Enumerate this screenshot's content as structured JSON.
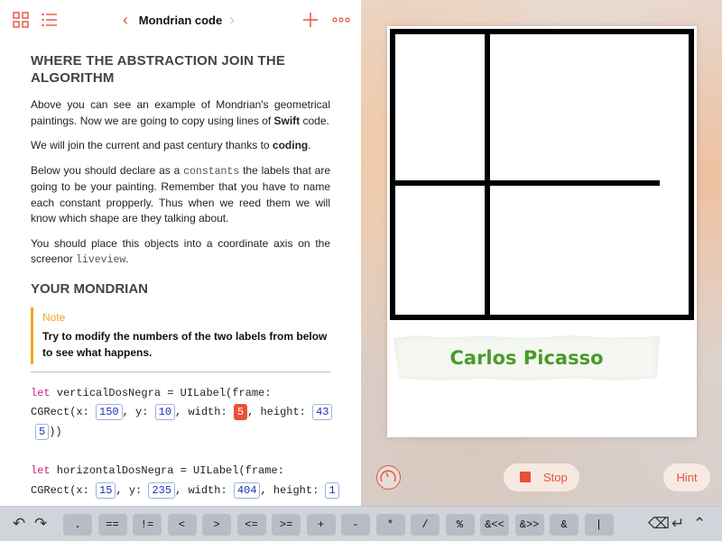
{
  "toolbar": {
    "title": "Mondrian code",
    "icons": [
      "grid-icon",
      "list-icon",
      "chevron-left-icon",
      "chevron-right-icon",
      "plus-icon",
      "more-icon"
    ]
  },
  "doc": {
    "heading1": "WHERE THE ABSTRACTION JOIN THE ALGORITHM",
    "p1": "Above you can see an example of Mondrian's geometrical paintings. Now we are going to copy using lines of ",
    "p1_bold": "Swift",
    "p1_end": " code.",
    "p2": "We will join the current and past century thanks to ",
    "p2_bold": "coding",
    "p2_end": ".",
    "p3_start": "Below you should declare as a ",
    "p3_code": "constants",
    "p3_end": " the labels that are going to be your painting. Remember that you have to name each constant propperly. Thus when we reed them we will know which shape are they talking about.",
    "p4_start": "You should place this objects into a coordinate axis on the screenor ",
    "p4_code": "liveview",
    "p4_end": ".",
    "heading2": "YOUR MONDRIAN",
    "note_label": "Note",
    "note_text": "Try to modify the numbers of the two labels from below to see what happens."
  },
  "code": {
    "line1_kw": "let",
    "line1_rest": " verticalDosNegra = UILabel(frame:",
    "line2_a": " CGRect(x: ",
    "line2_x": "150",
    "line2_b": ", y: ",
    "line2_y": "10",
    "line2_c": ", width: ",
    "line2_w": "5",
    "line2_d": ", height: ",
    "line2_h1": "43",
    "line3_h2": "5",
    "line3_end": "))",
    "line4_kw": "let",
    "line4_rest": " horizontalDosNegra = UILabel(frame:",
    "line5_a": " CGRect(x: ",
    "line5_x": "15",
    "line5_b": ", y: ",
    "line5_y": "235",
    "line5_c": ", width: ",
    "line5_w": "404",
    "line5_d": ", height: ",
    "line5_h": "1"
  },
  "liveview": {
    "caption": "Carlos Picasso",
    "stop_label": "Stop",
    "hint_label": "Hint"
  },
  "keyboard": {
    "undo_icon": "undo-icon",
    "redo_icon": "redo-icon",
    "keys": [
      ".",
      "==",
      "!=",
      "<",
      ">",
      "<=",
      ">=",
      "+",
      "-",
      "*",
      "/",
      "%",
      "&<<",
      "&>>",
      "&",
      "|"
    ],
    "delete_icon": "delete-icon",
    "return_icon": "return-icon",
    "hide_icon": "chevron-up-icon"
  },
  "colors": {
    "accent": "#e8503a",
    "note": "#f2a81c",
    "caption_green": "#4a9a2a",
    "keyword": "#c8237e",
    "token": "#1b2fbf"
  }
}
